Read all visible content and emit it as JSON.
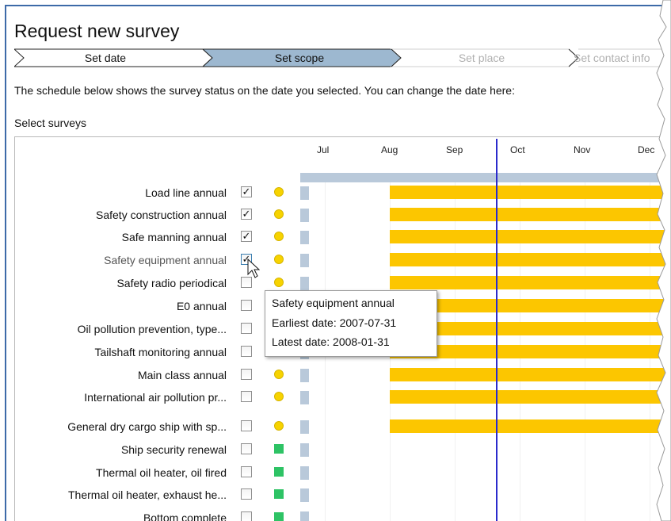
{
  "title": "Request new survey",
  "wizard": {
    "steps": [
      {
        "label": "Set date",
        "state": "done"
      },
      {
        "label": "Set scope",
        "state": "active"
      },
      {
        "label": "Set place",
        "state": "inactive"
      },
      {
        "label": "Set contact info",
        "state": "inactive"
      }
    ]
  },
  "info_text": "The schedule below shows the survey status on the date you selected. You can change the date here:",
  "select_label": "Select surveys",
  "timeline": {
    "months": [
      "Jul",
      "Aug",
      "Sep",
      "Oct",
      "Nov",
      "Dec"
    ]
  },
  "surveys": [
    {
      "label": "Load line annual",
      "checked": true,
      "status": "yellow-dot"
    },
    {
      "label": "Safety construction annual",
      "checked": true,
      "status": "yellow-dot"
    },
    {
      "label": "Safe manning annual",
      "checked": true,
      "status": "yellow-dot"
    },
    {
      "label": "Safety equipment annual",
      "checked": true,
      "status": "yellow-dot"
    },
    {
      "label": "Safety radio periodical",
      "checked": false,
      "status": "yellow-dot"
    },
    {
      "label": "E0 annual",
      "checked": false,
      "status": "yellow-dot"
    },
    {
      "label": "Oil pollution prevention, type...",
      "checked": false,
      "status": "yellow-dot"
    },
    {
      "label": "Tailshaft monitoring annual",
      "checked": false,
      "status": "yellow-dot"
    },
    {
      "label": "Main class annual",
      "checked": false,
      "status": "yellow-dot"
    },
    {
      "label": "International air pollution pr...",
      "checked": false,
      "status": "yellow-dot"
    },
    {
      "label": "General dry cargo ship with sp...",
      "checked": false,
      "status": "yellow-dot"
    },
    {
      "label": "Ship security renewal",
      "checked": false,
      "status": "green-square"
    },
    {
      "label": "Thermal oil heater, oil fired",
      "checked": false,
      "status": "green-square"
    },
    {
      "label": "Thermal oil heater, exhaust he...",
      "checked": false,
      "status": "green-square"
    },
    {
      "label": "Bottom complete",
      "checked": false,
      "status": "green-square"
    }
  ],
  "tooltip": {
    "title": "Safety equipment annual",
    "earliest": "Earliest date: 2007-07-31",
    "latest": "Latest date: 2008-01-31"
  },
  "colors": {
    "accent_border": "#3d6aa8",
    "active_step": "#9db8d0",
    "bar": "#fcc600",
    "status_yellow": "#f7d300",
    "status_green": "#2ec365",
    "current_date_line": "#2b2bcc"
  }
}
